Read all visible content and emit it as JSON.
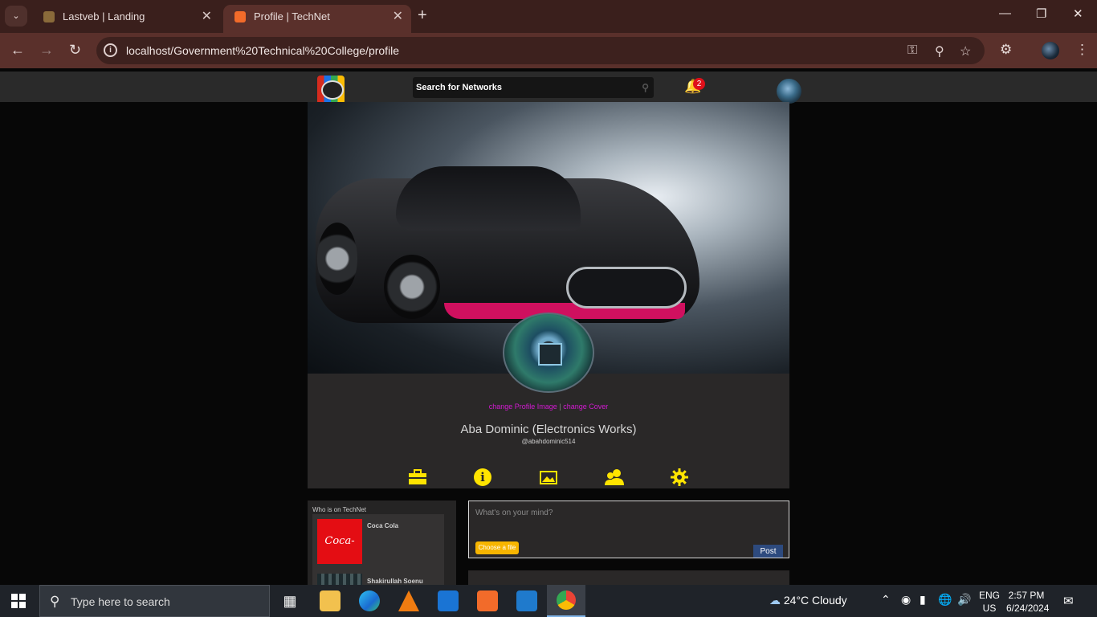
{
  "browser": {
    "tabs": [
      {
        "title": "Lastveb | Landing",
        "active": false
      },
      {
        "title": "Profile | TechNet",
        "active": true
      }
    ],
    "url": "localhost/Government%20Technical%20College/profile",
    "new_tab_label": "+"
  },
  "site": {
    "search_placeholder": "Search for Networks",
    "notification_count": "2"
  },
  "profile": {
    "change_profile_image": "change Profile Image",
    "separator": "|",
    "change_cover": "change Cover",
    "name": "Aba Dominic (Electronics Works)",
    "handle": "@abahdominic514",
    "tab_icons": [
      "briefcase-icon",
      "info-icon",
      "gallery-icon",
      "friends-icon",
      "settings-icon"
    ]
  },
  "sidebar": {
    "title": "Who is on TechNet",
    "users": [
      {
        "name": "Coca Cola",
        "logo_text": "Coca-Cola"
      },
      {
        "name": "Shakirullah Soenu"
      }
    ]
  },
  "composer": {
    "placeholder": "What's on your mind?",
    "choose_file_label": "Choose a file",
    "post_label": "Post"
  },
  "taskbar": {
    "search_placeholder": "Type here to search",
    "weather": "24°C  Cloudy",
    "lang_top": "ENG",
    "lang_bottom": "US",
    "time": "2:57 PM",
    "date": "6/24/2024"
  },
  "colors": {
    "accent_yellow": "#ffe400",
    "link_magenta": "#d21ad1",
    "post_blue": "#2d4a7e",
    "choose_orange": "#f7b500"
  }
}
